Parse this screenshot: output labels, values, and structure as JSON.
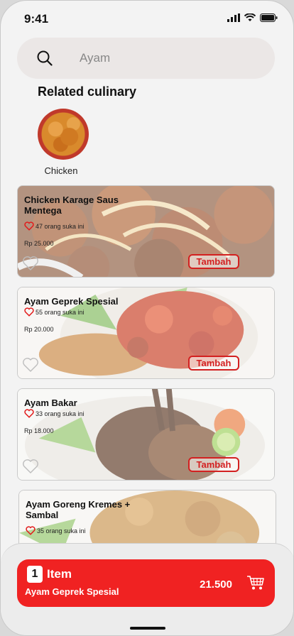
{
  "status": {
    "time": "9:41"
  },
  "search": {
    "value": "Ayam",
    "placeholder": "Ayam"
  },
  "related": {
    "title": "Related culinary",
    "categories": [
      {
        "label": "Chicken"
      }
    ]
  },
  "menu": {
    "items": [
      {
        "name": "Chicken Karage Saus Mentega",
        "likes": "47 orang suka ini",
        "price": "Rp 25.000",
        "add_label": "Tambah"
      },
      {
        "name": "Ayam Geprek Spesial",
        "likes": "55 orang suka ini",
        "price": "Rp 20.000",
        "add_label": "Tambah"
      },
      {
        "name": "Ayam Bakar",
        "likes": "33 orang suka ini",
        "price": "Rp 18.000",
        "add_label": "Tambah"
      },
      {
        "name": "Ayam Goreng Kremes + Sambal",
        "likes": "35 orang suka ini"
      }
    ]
  },
  "cart": {
    "count": "1",
    "label": "Item",
    "product": "Ayam Geprek Spesial",
    "total": "21.500"
  },
  "colors": {
    "accent": "#f02222",
    "button_border": "#d32020",
    "background": "#f3f3f3"
  }
}
